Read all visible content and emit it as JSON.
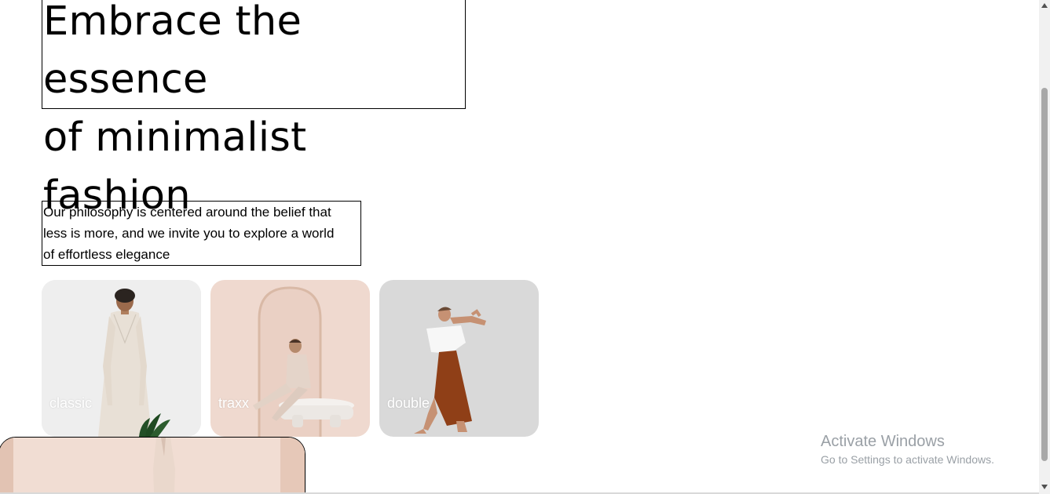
{
  "hero": {
    "line1": "Embrace the essence",
    "line2": "of minimalist fashion"
  },
  "philosophy": {
    "line1": "Our philosophy is centered around the belief that",
    "line2": "less is more, and we invite you to explore a world",
    "line3": "of effortless elegance"
  },
  "cards": [
    {
      "label": "classic"
    },
    {
      "label": "traxx"
    },
    {
      "label": "double"
    }
  ],
  "watermark": {
    "title": "Activate Windows",
    "subtitle": "Go to Settings to activate Windows."
  },
  "icons": {
    "scroll_up": "chevron-up-icon",
    "scroll_down": "chevron-down-icon"
  }
}
